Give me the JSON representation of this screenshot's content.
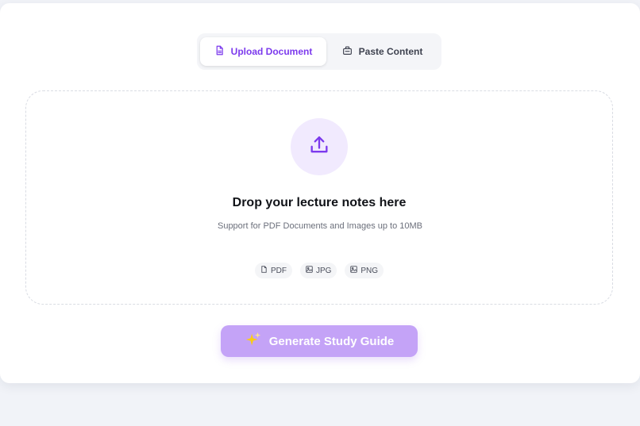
{
  "tabs": [
    {
      "label": "Upload Document",
      "icon": "document-icon",
      "active": true
    },
    {
      "label": "Paste Content",
      "icon": "clipboard-icon",
      "active": false
    }
  ],
  "dropzone": {
    "icon": "upload-icon",
    "title": "Drop your lecture notes here",
    "subtitle": "Support for PDF Documents and Images up to 10MB",
    "formats": [
      {
        "label": "PDF",
        "icon": "file-icon"
      },
      {
        "label": "JPG",
        "icon": "image-icon"
      },
      {
        "label": "PNG",
        "icon": "image-icon"
      }
    ]
  },
  "generate_button": {
    "label": "Generate Study Guide",
    "icon": "sparkles-icon"
  },
  "colors": {
    "accent": "#7c3aed",
    "button_bg": "#c4a3f7",
    "sparkle": "#facc15",
    "page_bg": "#f1f3f8"
  }
}
